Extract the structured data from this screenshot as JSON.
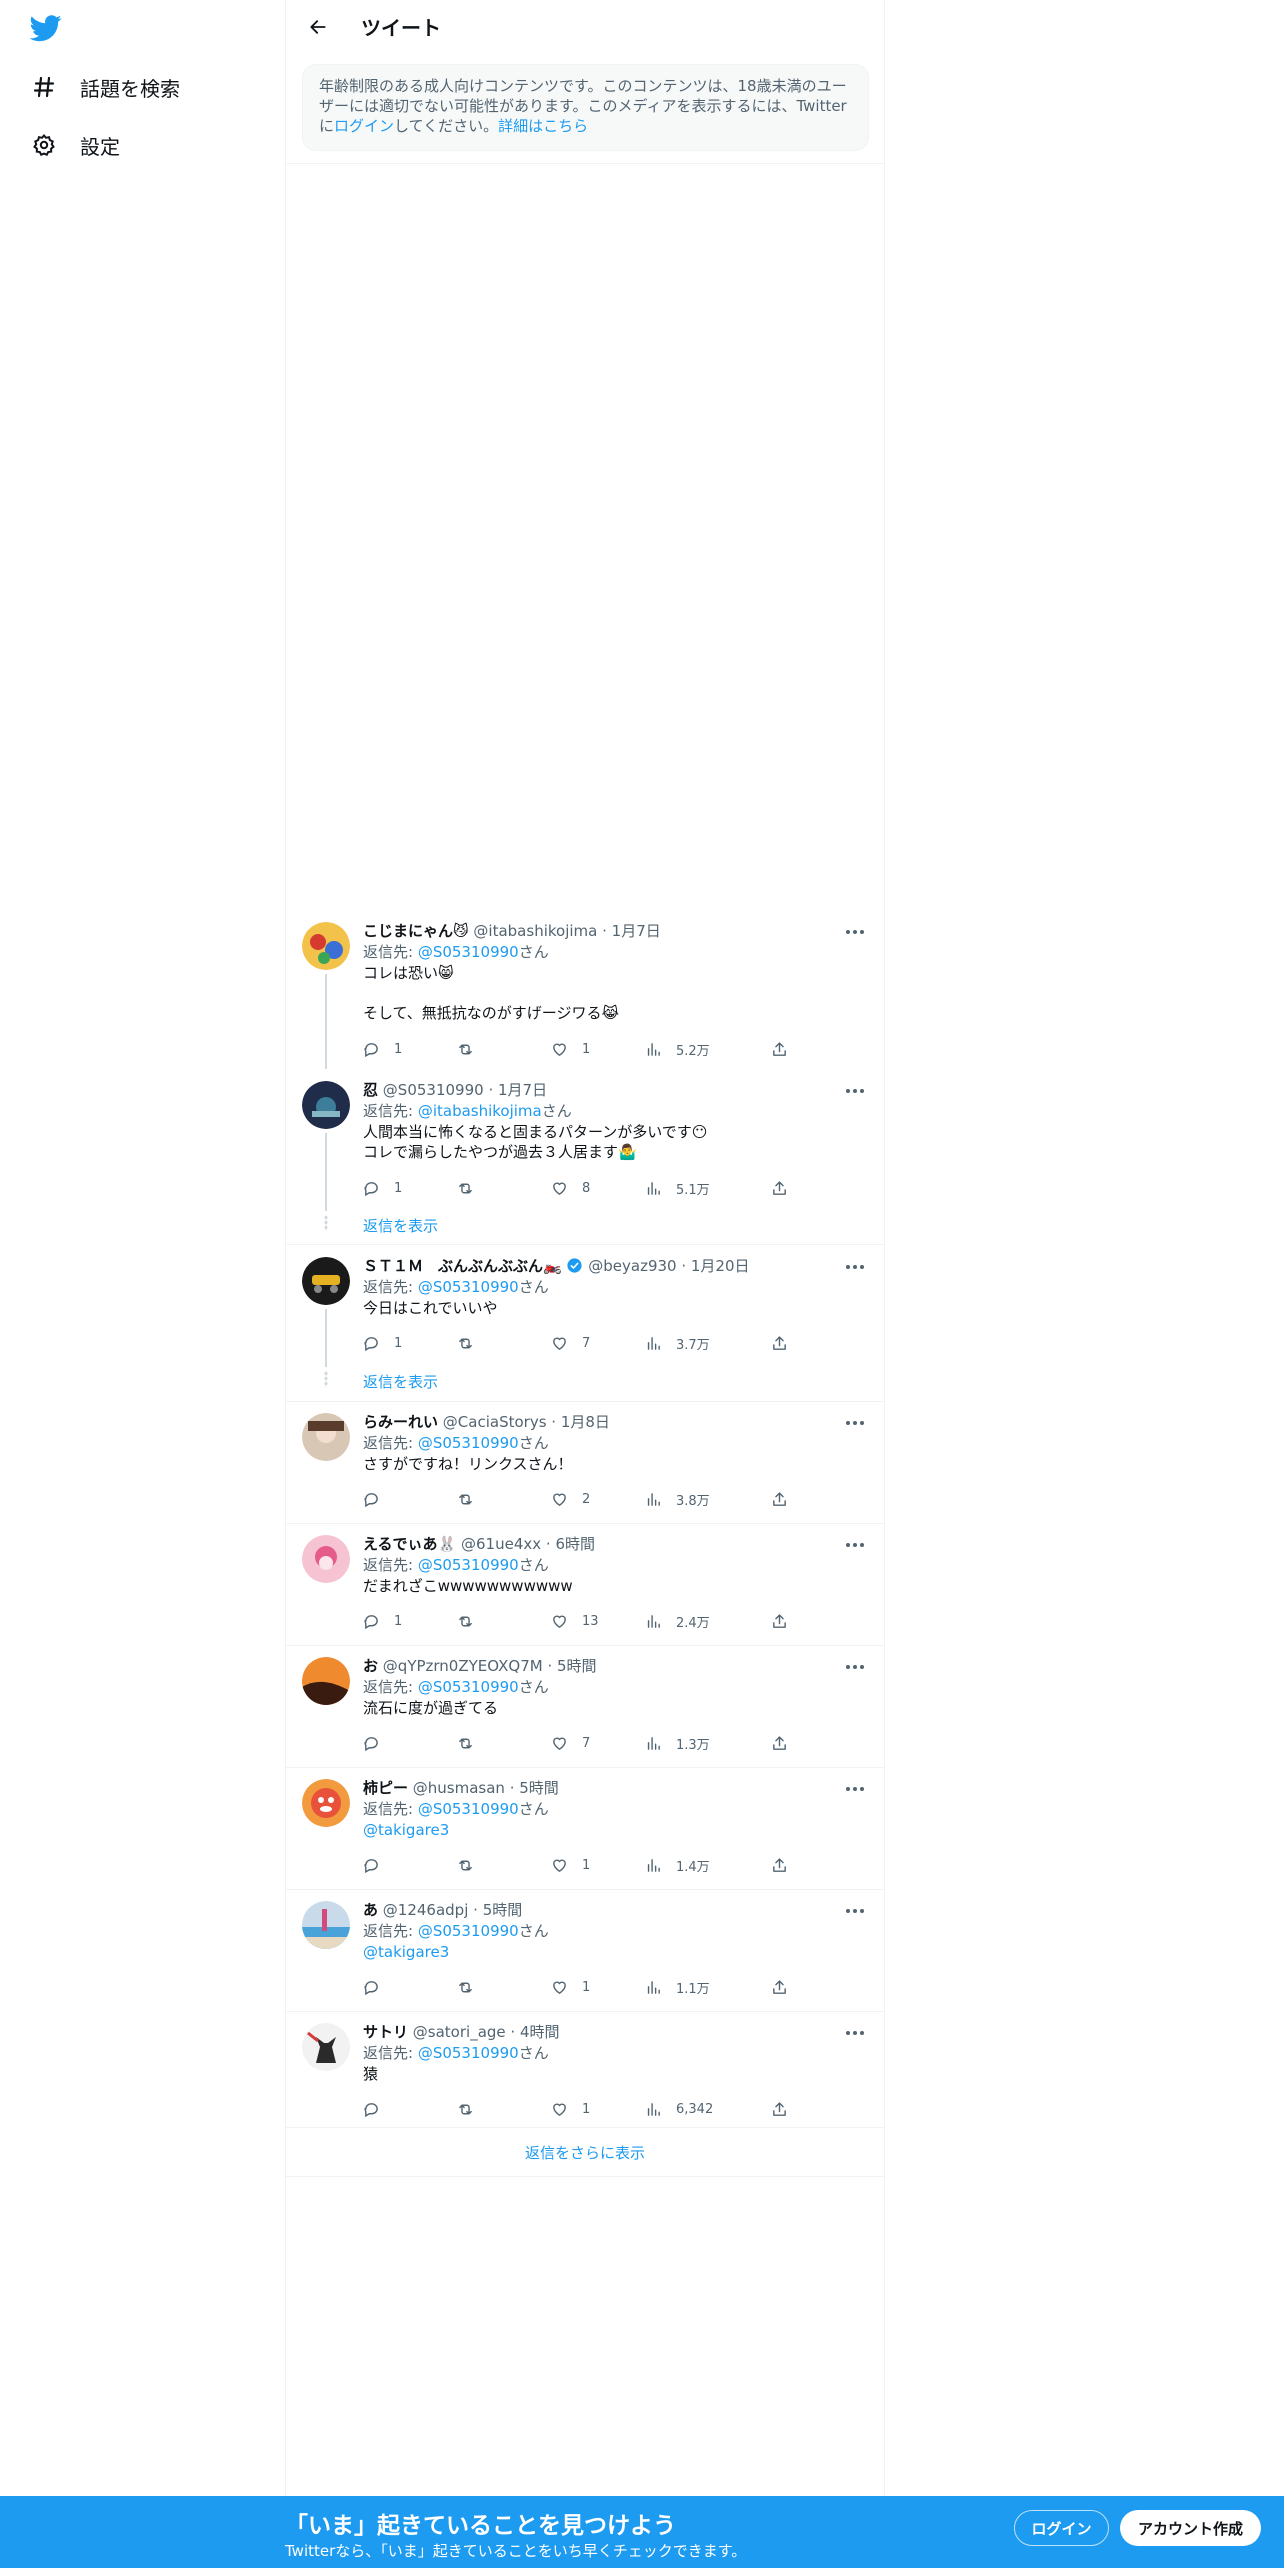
{
  "nav": {
    "explore_label": "話題を検索",
    "settings_label": "設定"
  },
  "header": {
    "title": "ツイート"
  },
  "notice": {
    "text_1": "年齢制限のある成人向けコンテンツです。このコンテンツは、18歳未満のユーザーには適切でない可能性があります。このメディアを表示するには、Twitterに",
    "login_link": "ログイン",
    "text_2": "してください。",
    "learn_more": "詳細はこちら"
  },
  "reply_to_label": "返信先: ",
  "san": "さん",
  "show_replies": "返信を表示",
  "more_replies": "返信をさらに表示",
  "tweets": [
    {
      "name": "こじまにゃん😼",
      "handle": "@itabashikojima",
      "time": "1月7日",
      "reply_to": "@S05310990",
      "text": "コレは恐い😸\n\nそして、無抵抗なのがすげージワる😹",
      "replies": "1",
      "retweets": "",
      "likes": "1",
      "views": "5.2万"
    },
    {
      "name": "忍",
      "handle": "@S05310990",
      "time": "1月7日",
      "reply_to": "@itabashikojima",
      "text": "人間本当に怖くなると固まるパターンが多いです😶\nコレで漏らしたやつが過去３人居ます🤷‍♂️",
      "replies": "1",
      "retweets": "",
      "likes": "8",
      "views": "5.1万"
    },
    {
      "name": "ＳＴ１Ｍ　ぶんぶんぶぶん🏍️",
      "handle": "@beyaz930",
      "time": "1月20日",
      "reply_to": "@S05310990",
      "text": "今日はこれでいいや",
      "replies": "1",
      "retweets": "",
      "likes": "7",
      "views": "3.7万"
    },
    {
      "name": "らみーれい",
      "handle": "@CaciaStorys",
      "time": "1月8日",
      "reply_to": "@S05310990",
      "text": "さすがですね！リンクスさん！",
      "replies": "",
      "retweets": "",
      "likes": "2",
      "views": "3.8万"
    },
    {
      "name": "えるでぃあ🐰",
      "handle": "@61ue4xx",
      "time": "6時間",
      "reply_to": "@S05310990",
      "text": "だまれざこwwwwwwwwwww",
      "replies": "1",
      "retweets": "",
      "likes": "13",
      "views": "2.4万"
    },
    {
      "name": "お",
      "handle": "@qYPzrn0ZYEOXQ7M",
      "time": "5時間",
      "reply_to": "@S05310990",
      "text": "流石に度が過ぎてる",
      "replies": "",
      "retweets": "",
      "likes": "7",
      "views": "1.3万"
    },
    {
      "name": "柿ピー",
      "handle": "@husmasan",
      "time": "5時間",
      "reply_to": "@S05310990",
      "mention": "@takigare3",
      "replies": "",
      "retweets": "",
      "likes": "1",
      "views": "1.4万"
    },
    {
      "name": "あ",
      "handle": "@1246adpj",
      "time": "5時間",
      "reply_to": "@S05310990",
      "mention": "@takigare3",
      "replies": "",
      "retweets": "",
      "likes": "1",
      "views": "1.1万"
    },
    {
      "name": "サトリ",
      "handle": "@satori_age",
      "time": "4時間",
      "reply_to": "@S05310990",
      "text": "猿",
      "replies": "",
      "retweets": "",
      "likes": "1",
      "views": "6,342"
    }
  ],
  "bottombar": {
    "title": "「いま」起きていることを見つけよう",
    "subtitle": "Twitterなら、「いま」起きていることをいち早くチェックできます。",
    "login": "ログイン",
    "signup": "アカウント作成"
  },
  "colors": {
    "accent": "#1d9bf0",
    "text": "#0f1419",
    "muted": "#536471",
    "border": "#eff3f4"
  }
}
